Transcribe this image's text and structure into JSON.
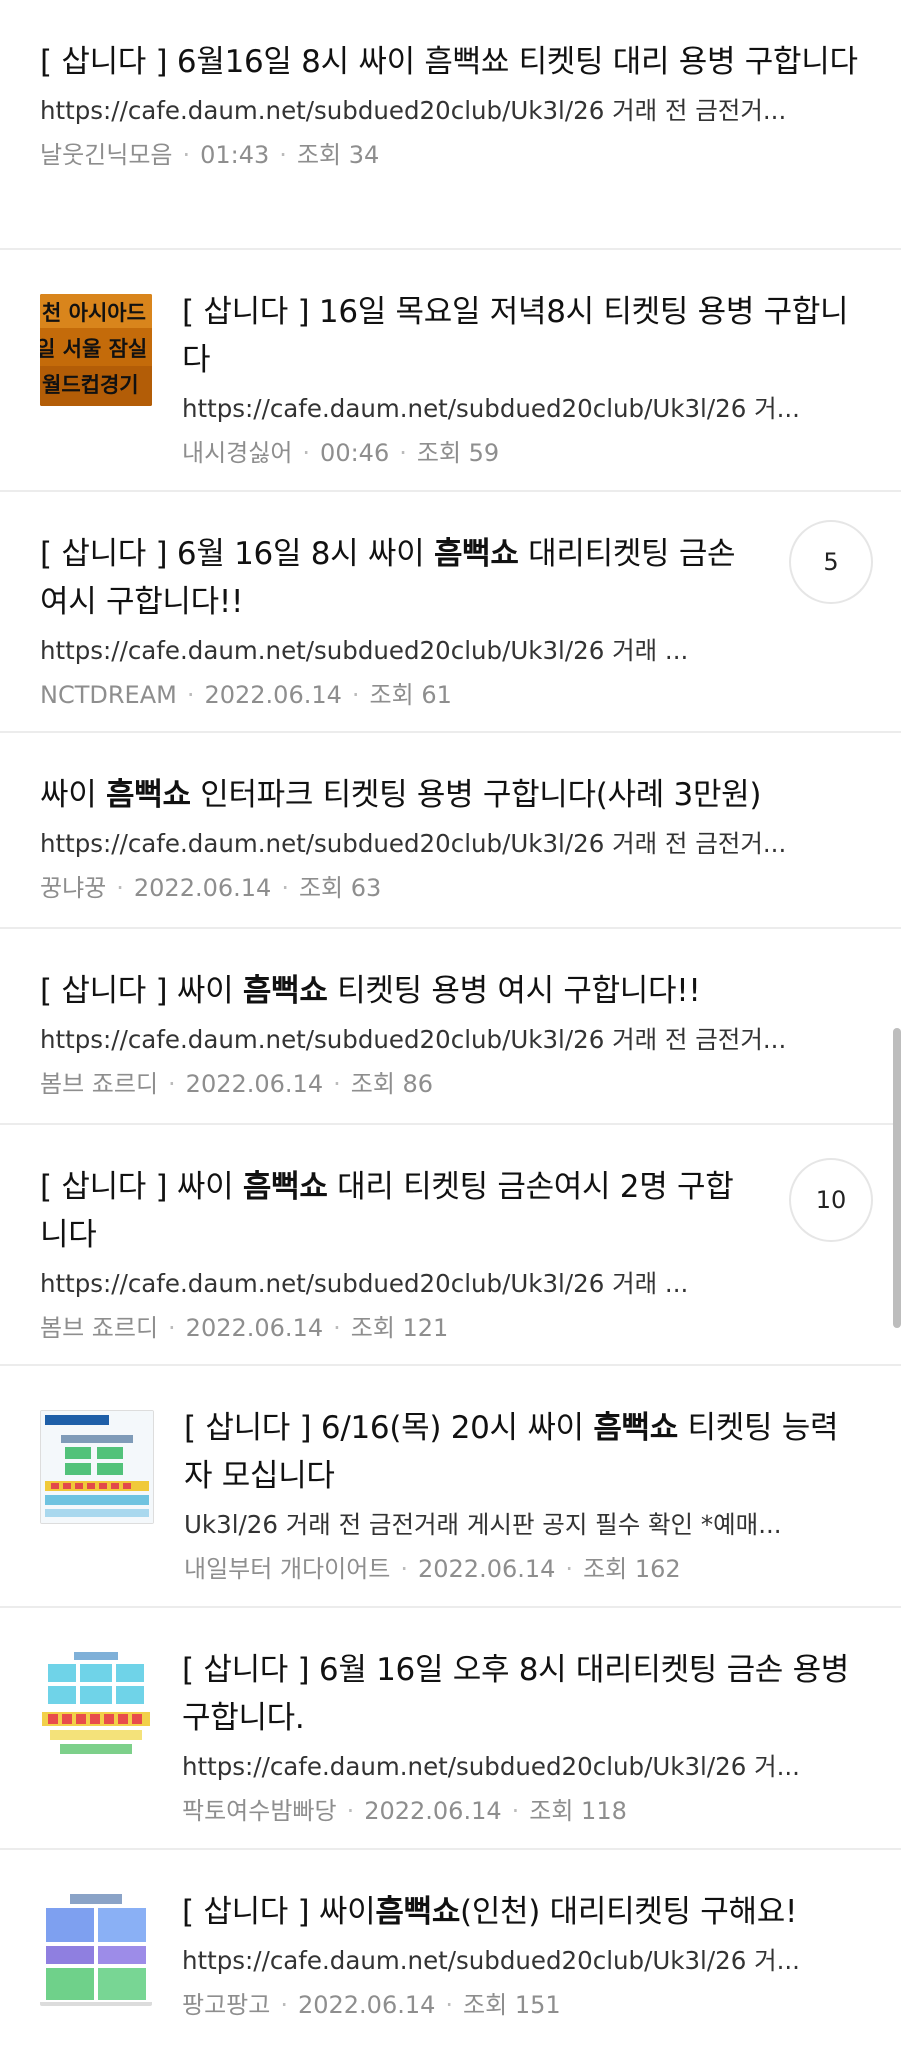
{
  "posts": [
    {
      "prefix": "[ 삽니다 ] ",
      "title_before": "6월16일 8시 싸이 흠뻑쑈 티켓팅 대리 용병 구합니다",
      "title_bold": "",
      "title_after": "",
      "url": "https://cafe.daum.net/subdued20club/Uk3l/26 거래 전 금전거...",
      "author": "날웃긴닉모음",
      "time": "01:43",
      "views": "조회 34",
      "comments": ""
    },
    {
      "prefix": "[ 삽니다 ] ",
      "title_before": "16일 목요일 저녁8시 티켓팅 용병 구합니다",
      "title_bold": "",
      "title_after": "",
      "url": "https://cafe.daum.net/subdued20club/Uk3l/26 거...",
      "author": "내시경싫어",
      "time": "00:46",
      "views": "조회 59",
      "comments": "",
      "thumb_text": [
        "천 아시아드",
        "일 서울 잠실",
        "월드컵경기"
      ]
    },
    {
      "prefix": "[ 삽니다 ] ",
      "title_before": "6월 16일 8시 싸이 ",
      "title_bold": "흠뻑쇼",
      "title_after": " 대리티켓팅 금손 여시 구합니다!!",
      "url": "https://cafe.daum.net/subdued20club/Uk3l/26 거래 ...",
      "author": "NCTDREAM",
      "time": "2022.06.14",
      "views": "조회 61",
      "comments": "5"
    },
    {
      "prefix": "",
      "title_before": "싸이 ",
      "title_bold": "흠뻑쇼",
      "title_after": " 인터파크 티켓팅 용병 구합니다(사례 3만원)",
      "url": "https://cafe.daum.net/subdued20club/Uk3l/26 거래 전 금전거...",
      "author": "꿍냐꿍",
      "time": "2022.06.14",
      "views": "조회 63",
      "comments": ""
    },
    {
      "prefix": "[ 삽니다 ] ",
      "title_before": "싸이 ",
      "title_bold": "흠뻑쇼",
      "title_after": " 티켓팅 용병 여시 구합니다!!",
      "url": "https://cafe.daum.net/subdued20club/Uk3l/26 거래 전 금전거...",
      "author": "봄브 죠르디",
      "time": "2022.06.14",
      "views": "조회 86",
      "comments": ""
    },
    {
      "prefix": "[ 삽니다 ] ",
      "title_before": "싸이 ",
      "title_bold": "흠뻑쇼",
      "title_after": " 대리 티켓팅 금손여시 2명 구합니다",
      "url": "https://cafe.daum.net/subdued20club/Uk3l/26 거래 ...",
      "author": "봄브 죠르디",
      "time": "2022.06.14",
      "views": "조회 121",
      "comments": "10"
    },
    {
      "prefix": "[ 삽니다 ] ",
      "title_before": "6/16(목) 20시 싸이 ",
      "title_bold": "흠뻑쇼",
      "title_after": " 티켓팅 능력자 모십니다",
      "url": "Uk3l/26 거래 전 금전거래 게시판 공지 필수 확인 *예매...",
      "author": "내일부터 개다이어트",
      "time": "2022.06.14",
      "views": "조회 162",
      "comments": ""
    },
    {
      "prefix": "[ 삽니다 ] ",
      "title_before": "6월 16일 오후 8시 대리티켓팅 금손 용병구합니다.",
      "title_bold": "",
      "title_after": "",
      "url": "https://cafe.daum.net/subdued20club/Uk3l/26 거...",
      "author": "팍토여수밤빠당",
      "time": "2022.06.14",
      "views": "조회 118",
      "comments": ""
    },
    {
      "prefix": "[ 삽니다 ] ",
      "title_before": "싸이",
      "title_bold": "흠뻑쇼",
      "title_after": "(인천) 대리티켓팅 구해요!",
      "url": "https://cafe.daum.net/subdued20club/Uk3l/26 거...",
      "author": "팡고팡고",
      "time": "2022.06.14",
      "views": "조회 151",
      "comments": ""
    }
  ]
}
